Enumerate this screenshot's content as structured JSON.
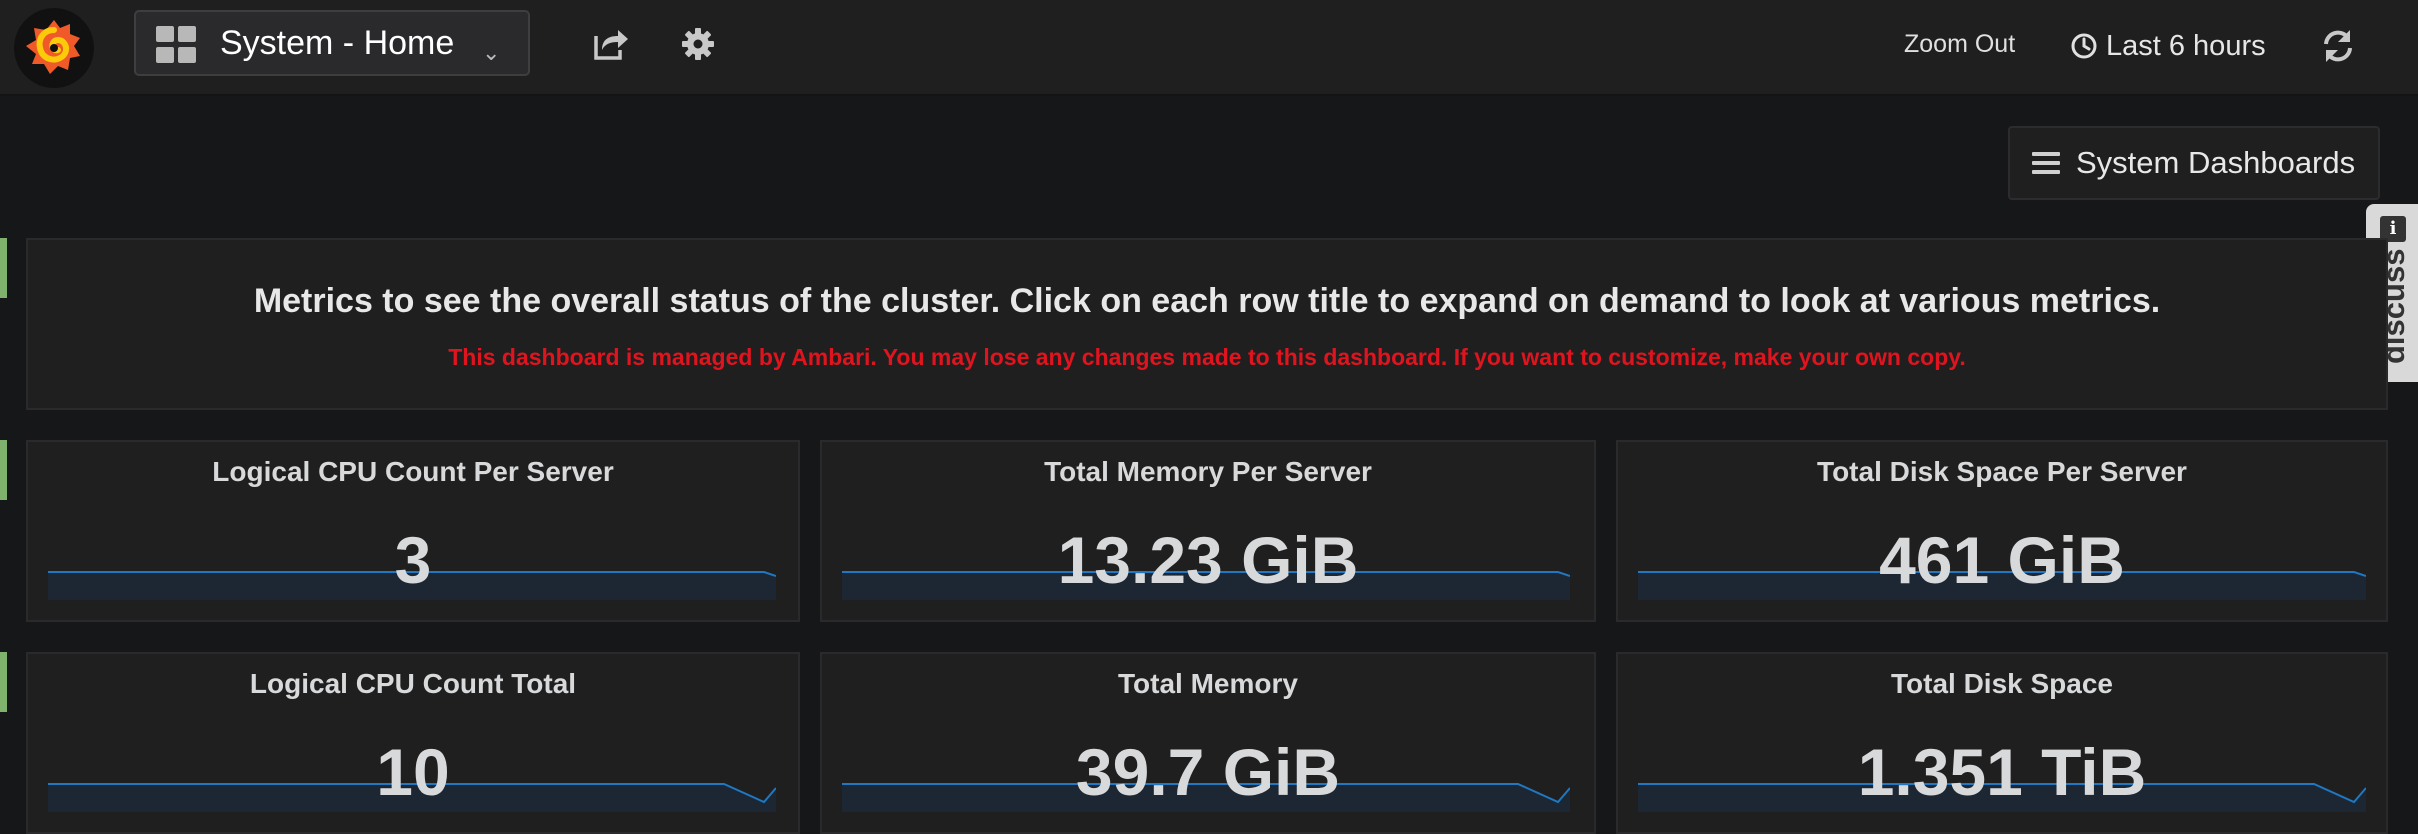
{
  "navbar": {
    "dashboard_title": "System - Home",
    "zoom_out_label": "Zoom Out",
    "time_range_label": "Last 6 hours"
  },
  "system_dashboards": {
    "label": "System Dashboards"
  },
  "discuss": {
    "label": "discuss",
    "info_glyph": "i"
  },
  "text_panel": {
    "headline": "Metrics to see the overall status of the cluster. Click on each row title to expand on demand to look at various metrics.",
    "warning": "This dashboard is managed by Ambari. You may lose any changes made to this dashboard. If you want to customize, make your own copy."
  },
  "rows": [
    {
      "panels": [
        {
          "title": "Logical CPU Count Per Server",
          "value": "3"
        },
        {
          "title": "Total Memory Per Server",
          "value": "13.23 GiB"
        },
        {
          "title": "Total Disk Space Per Server",
          "value": "461 GiB"
        }
      ]
    },
    {
      "panels": [
        {
          "title": "Logical CPU Count Total",
          "value": "10"
        },
        {
          "title": "Total Memory",
          "value": "39.7 GiB"
        },
        {
          "title": "Total Disk Space",
          "value": "1.351 TiB"
        }
      ]
    }
  ],
  "icons": {
    "logo": "grafana-logo-icon",
    "dashboard_grid": "dashboard-grid-icon",
    "share": "share-icon",
    "settings": "gear-icon",
    "clock": "clock-icon",
    "refresh": "refresh-icon",
    "menu": "hamburger-icon"
  },
  "colors": {
    "background": "#161719",
    "panel": "#1f1f20",
    "row_marker": "#7eb26d",
    "warning_text": "#e0141e",
    "sparkline_line": "#1f78c1",
    "sparkline_fill": "#1c2733",
    "logo_orange": "#f05a28"
  }
}
